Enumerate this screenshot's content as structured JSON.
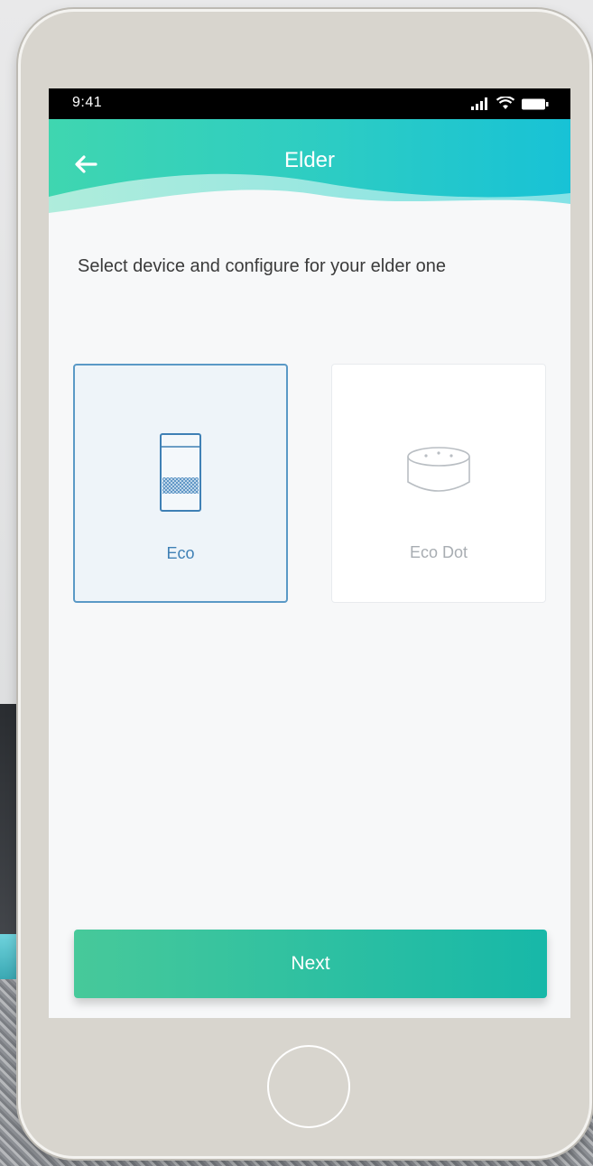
{
  "status_bar": {
    "time": "9:41"
  },
  "header": {
    "title": "Elder",
    "back_icon": "arrow-left-icon"
  },
  "instruction": "Select device and configure for your elder one",
  "devices": [
    {
      "label": "Eco",
      "icon": "eco-speaker-icon",
      "selected": true
    },
    {
      "label": "Eco Dot",
      "icon": "eco-dot-icon",
      "selected": false
    }
  ],
  "next_button": {
    "label": "Next"
  },
  "colors": {
    "header_gradient_start": "#3fd6b0",
    "header_gradient_end": "#18c2d6",
    "selected_border": "#5a99c6",
    "button_gradient_start": "#47c99a",
    "button_gradient_end": "#17b8a8"
  }
}
